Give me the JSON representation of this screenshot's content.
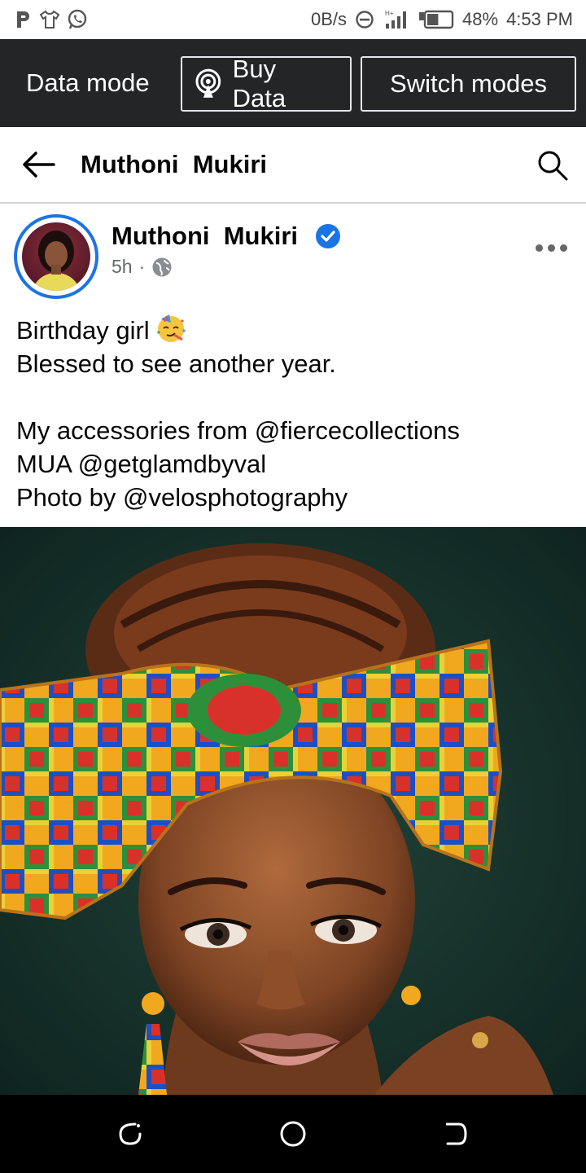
{
  "status_bar": {
    "left_icons": [
      "pocket-icon",
      "shirt-icon",
      "whatsapp-icon"
    ],
    "network_speed": "0B/s",
    "battery_percent": "48%",
    "time": "4:53 PM",
    "battery_level": 0.48
  },
  "data_bar": {
    "mode_label": "Data mode",
    "buy_data_label": "Buy Data",
    "switch_modes_label": "Switch modes"
  },
  "header": {
    "title": "Muthoni  Mukiri"
  },
  "post": {
    "author": "Muthoni  Mukiri",
    "verified": true,
    "time": "5h",
    "separator": "·",
    "audience_icon": "globe-icon",
    "text_lines": [
      "Birthday girl",
      "Blessed to see another year.",
      "My accessories from @fiercecollections",
      "MUA @getglamdbyval",
      "Photo by @velosphotography"
    ]
  },
  "colors": {
    "accent": "#1b74e4",
    "data_bar_bg": "#242526",
    "text": "#050505",
    "meta": "#65676b"
  }
}
